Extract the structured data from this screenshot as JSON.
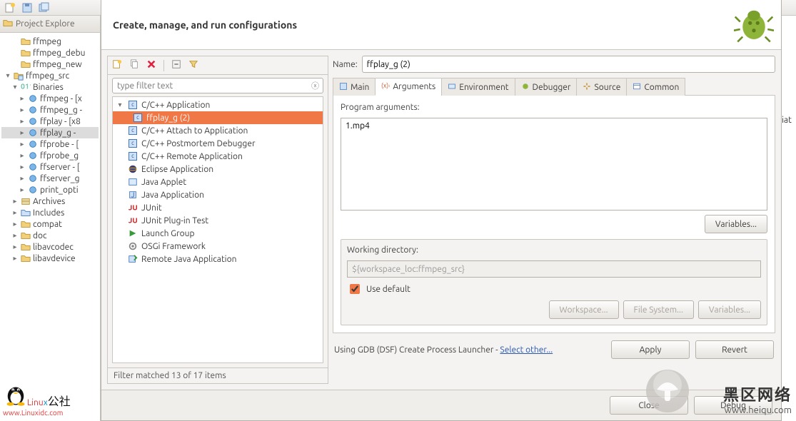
{
  "toolbar": {
    "new_menu": "New",
    "save": "Save",
    "saveall": "Save All"
  },
  "project_explorer": {
    "title": "Project Explore",
    "items": [
      {
        "label": "ffmpeg",
        "icon": "folder",
        "indent": 1,
        "toggle": ""
      },
      {
        "label": "ffmpeg_debu",
        "icon": "folder",
        "indent": 1,
        "toggle": ""
      },
      {
        "label": "ffmpeg_new",
        "icon": "folder",
        "indent": 1,
        "toggle": ""
      },
      {
        "label": "ffmpeg_src",
        "icon": "cproj",
        "indent": 0,
        "toggle": "▾"
      },
      {
        "label": "Binaries",
        "icon": "bin",
        "indent": 1,
        "toggle": "▾"
      },
      {
        "label": "ffmpeg - [x",
        "icon": "obj",
        "indent": 2,
        "toggle": "▸"
      },
      {
        "label": "ffmpeg_g -",
        "icon": "obj",
        "indent": 2,
        "toggle": "▸"
      },
      {
        "label": "ffplay - [x8",
        "icon": "obj",
        "indent": 2,
        "toggle": "▸"
      },
      {
        "label": "ffplay_g - ",
        "icon": "obj",
        "indent": 2,
        "toggle": "▸",
        "sel": true
      },
      {
        "label": "ffprobe - [",
        "icon": "obj",
        "indent": 2,
        "toggle": "▸"
      },
      {
        "label": "ffprobe_g",
        "icon": "obj",
        "indent": 2,
        "toggle": "▸"
      },
      {
        "label": "ffserver - [",
        "icon": "obj",
        "indent": 2,
        "toggle": "▸"
      },
      {
        "label": "ffserver_g",
        "icon": "obj",
        "indent": 2,
        "toggle": "▸"
      },
      {
        "label": "print_opti",
        "icon": "obj",
        "indent": 2,
        "toggle": "▸"
      },
      {
        "label": "Archives",
        "icon": "arch",
        "indent": 1,
        "toggle": "▸"
      },
      {
        "label": "Includes",
        "icon": "inc",
        "indent": 1,
        "toggle": "▸"
      },
      {
        "label": "compat",
        "icon": "folder",
        "indent": 1,
        "toggle": "▸"
      },
      {
        "label": "doc",
        "icon": "folder",
        "indent": 1,
        "toggle": "▸"
      },
      {
        "label": "libavcodec",
        "icon": "folder",
        "indent": 1,
        "toggle": "▸"
      },
      {
        "label": "libavdevice",
        "icon": "folder",
        "indent": 1,
        "toggle": "▸"
      }
    ]
  },
  "dialog": {
    "title": "Create, manage, and run configurations",
    "filter_placeholder": "type filter text",
    "config_types": [
      {
        "label": "C/C++ Application",
        "icon": "c",
        "expanded": true,
        "children": [
          {
            "label": "ffplay_g (2)",
            "sel": true
          }
        ]
      },
      {
        "label": "C/C++ Attach to Application",
        "icon": "c"
      },
      {
        "label": "C/C++ Postmortem Debugger",
        "icon": "c"
      },
      {
        "label": "C/C++ Remote Application",
        "icon": "c"
      },
      {
        "label": "Eclipse Application",
        "icon": "eclipse"
      },
      {
        "label": "Java Applet",
        "icon": "applet"
      },
      {
        "label": "Java Application",
        "icon": "java"
      },
      {
        "label": "JUnit",
        "icon": "junit"
      },
      {
        "label": "JUnit Plug-in Test",
        "icon": "junit"
      },
      {
        "label": "Launch Group",
        "icon": "lgroup"
      },
      {
        "label": "OSGi Framework",
        "icon": "osgi"
      },
      {
        "label": "Remote Java Application",
        "icon": "rjava"
      }
    ],
    "filter_status": "Filter matched 13 of 17 items",
    "name_label": "Name:",
    "name_value": "ffplay_g (2)",
    "tabs": {
      "main": "Main",
      "arguments": "Arguments",
      "environment": "Environment",
      "debugger": "Debugger",
      "source": "Source",
      "common": "Common"
    },
    "arguments": {
      "program_args_label": "Program arguments:",
      "program_args_value": "1.mp4",
      "variables_btn": "Variables...",
      "working_dir_label": "Working directory:",
      "working_dir_value": "${workspace_loc:ffmpeg_src}",
      "use_default_label": "Use default",
      "workspace_btn": "Workspace...",
      "filesystem_btn": "File System...",
      "variables2_btn": "Variables..."
    },
    "launcher_prefix": "Using GDB (DSF) Create Process Launcher - ",
    "launcher_link": "Select other...",
    "apply": "Apply",
    "revert": "Revert",
    "close": "Close",
    "debug": "Debug"
  },
  "right_strip": "iat",
  "watermark_left": {
    "big1": "Linu",
    "big2": "x",
    "sub": "公社",
    "url": "www.Linuxidc.com"
  },
  "watermark_right": {
    "cn": "黑区网络",
    "url": "www.heiqu.com"
  }
}
